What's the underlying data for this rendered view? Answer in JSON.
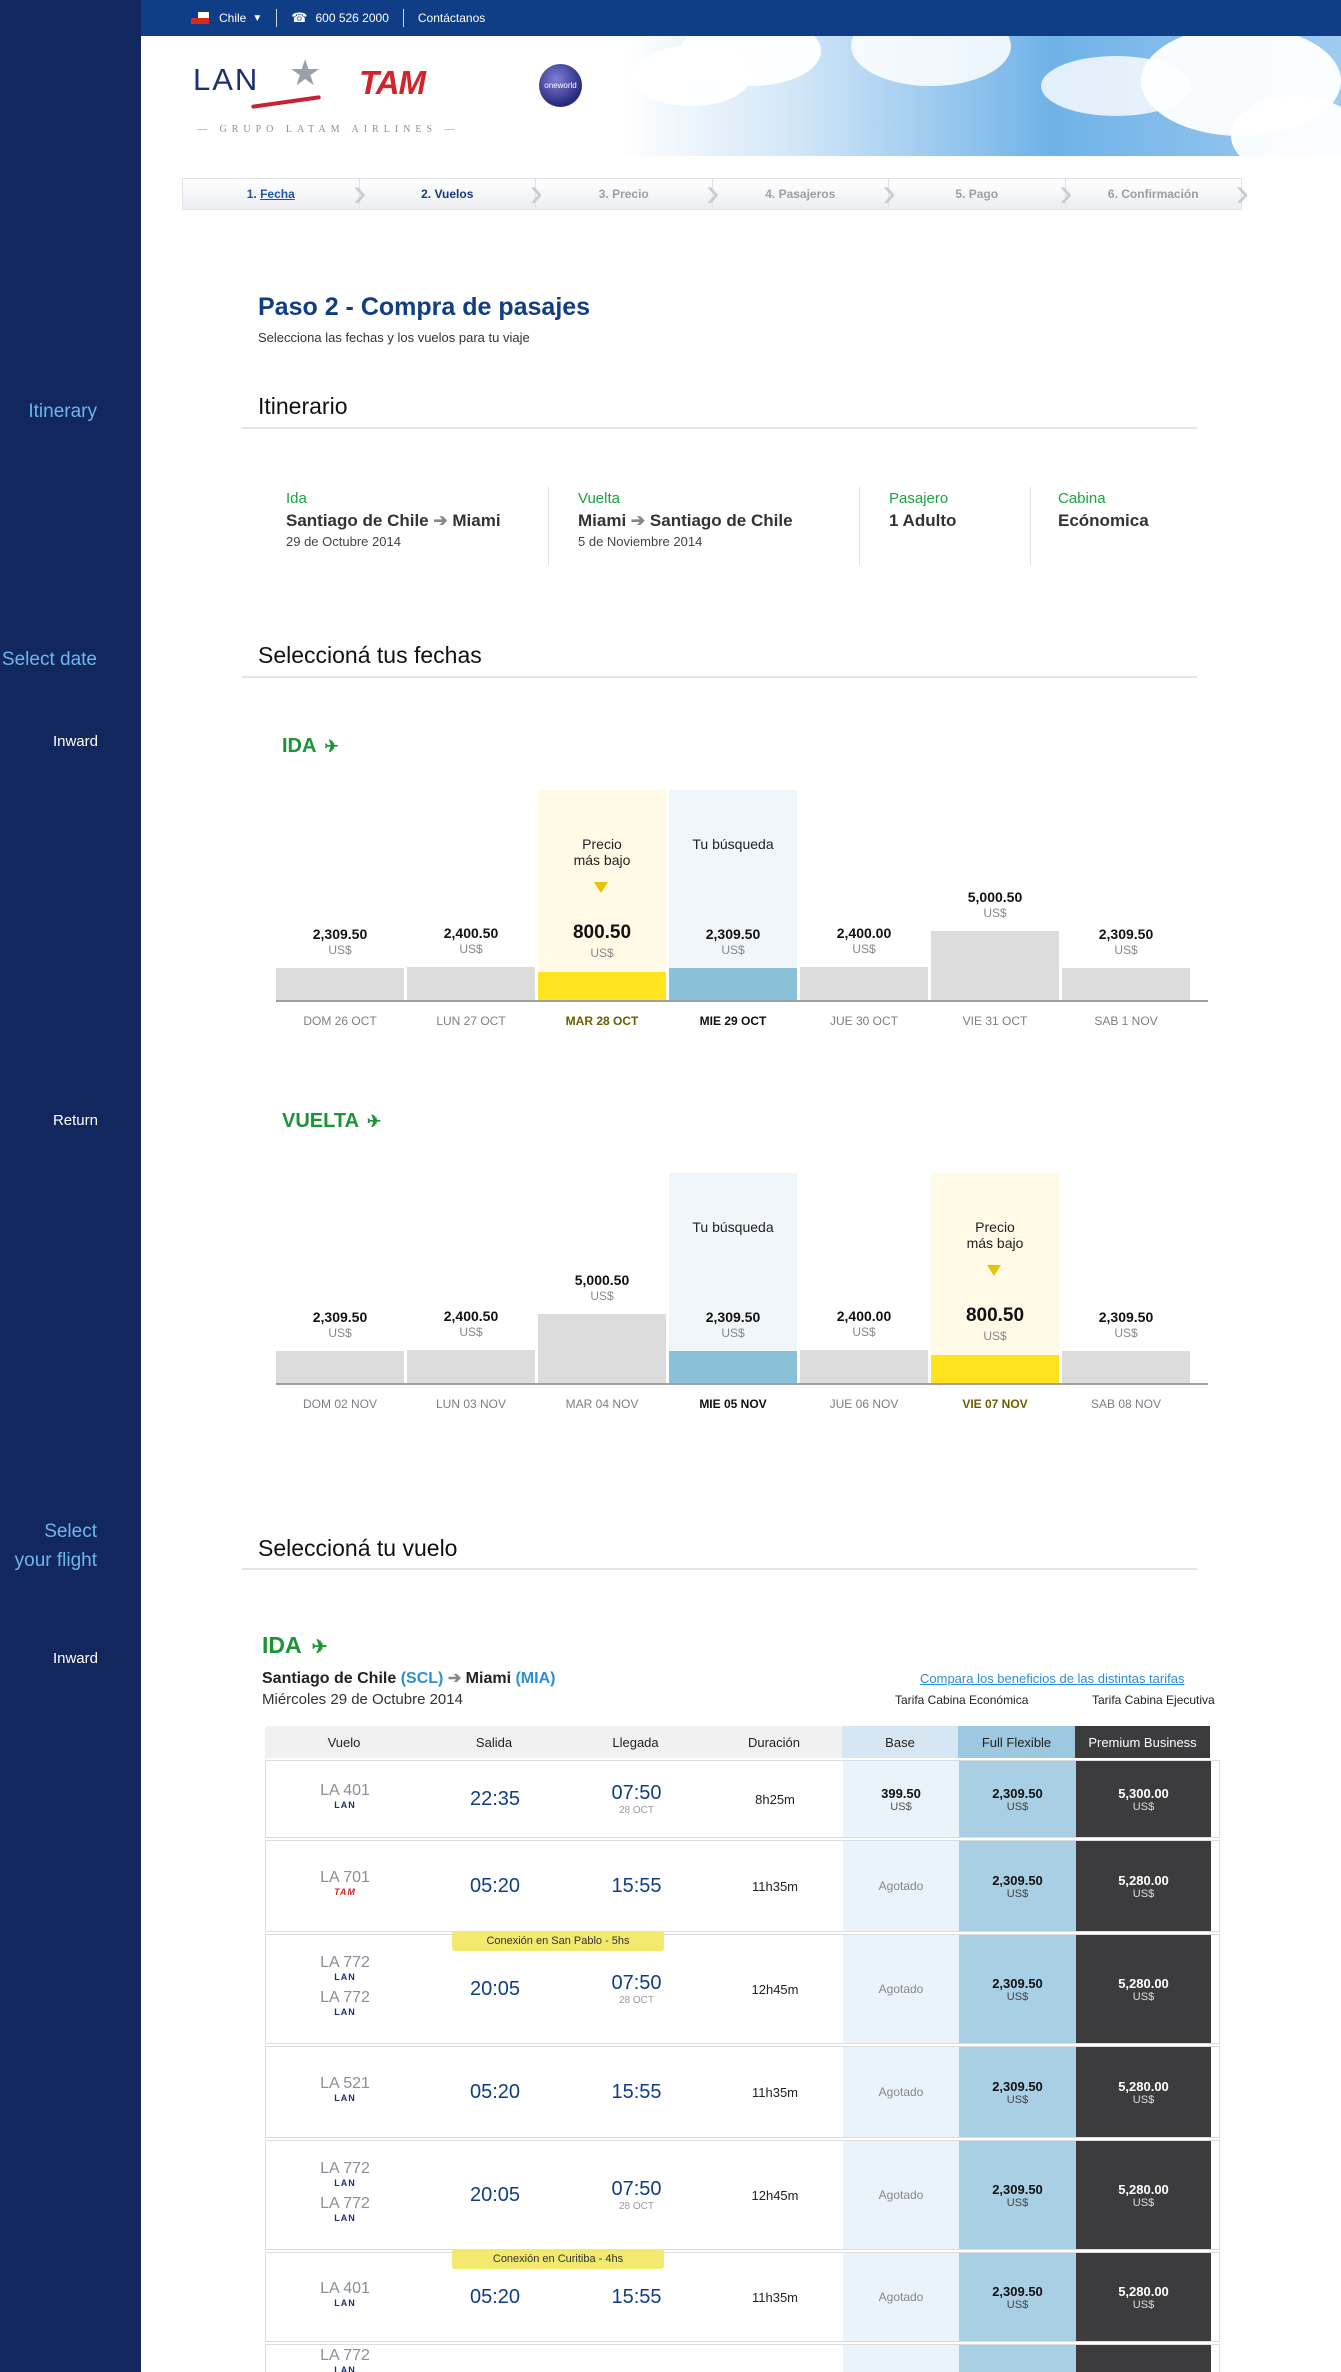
{
  "annotations": {
    "itinerary": "Itinerary",
    "select_date": "Select date",
    "inward_1": "Inward",
    "return": "Return",
    "select_flight_1": "Select",
    "select_flight_2": "your flight",
    "inward_2": "Inward"
  },
  "topbar": {
    "country": "Chile",
    "phone": "600 526 2000",
    "contact": "Contáctanos"
  },
  "brand": {
    "lan": "LAN",
    "tam": "TAM",
    "oneworld": "oneworld",
    "group": "— GRUPO LATAM AIRLINES —"
  },
  "steps": [
    {
      "num": "1.",
      "label": "Fecha"
    },
    {
      "num": "2.",
      "label": "Vuelos"
    },
    {
      "num": "3.",
      "label": "Precio"
    },
    {
      "num": "4.",
      "label": "Pasajeros"
    },
    {
      "num": "5.",
      "label": "Pago"
    },
    {
      "num": "6.",
      "label": "Confirmación"
    }
  ],
  "page": {
    "title": "Paso 2 - Compra de pasajes",
    "subtitle": "Selecciona las fechas y los vuelos para tu viaje"
  },
  "itinerary": {
    "heading": "Itinerario",
    "ida_label": "Ida",
    "ida_from": "Santiago de Chile",
    "ida_to": "Miami",
    "ida_date": "29 de Octubre 2014",
    "vuelta_label": "Vuelta",
    "vuelta_from": "Miami",
    "vuelta_to": "Santiago de Chile",
    "vuelta_date": "5 de Noviembre 2014",
    "pasajero_label": "Pasajero",
    "pasajero_value": "1 Adulto",
    "cabina_label": "Cabina",
    "cabina_value": "Ecónomica"
  },
  "dates": {
    "heading": "Seleccioná tus fechas",
    "currency": "US$",
    "lowest_note_1": "Precio",
    "lowest_note_2": "más bajo",
    "search_note": "Tu búsqueda",
    "ida": {
      "label": "IDA",
      "days": [
        {
          "date": "DOM 26 OCT",
          "price": "2,309.50",
          "value": 2309.5,
          "kind": "normal"
        },
        {
          "date": "LUN 27 OCT",
          "price": "2,400.50",
          "value": 2400.5,
          "kind": "normal"
        },
        {
          "date": "MAR 28 OCT",
          "price": "800.50",
          "value": 800.5,
          "kind": "lowest"
        },
        {
          "date": "MIE 29 OCT",
          "price": "2,309.50",
          "value": 2309.5,
          "kind": "search"
        },
        {
          "date": "JUE 30 OCT",
          "price": "2,400.00",
          "value": 2400.0,
          "kind": "normal"
        },
        {
          "date": "VIE 31 OCT",
          "price": "5,000.50",
          "value": 5000.5,
          "kind": "normal"
        },
        {
          "date": "SAB 1 NOV",
          "price": "2,309.50",
          "value": 2309.5,
          "kind": "normal"
        }
      ]
    },
    "vuelta": {
      "label": "VUELTA",
      "days": [
        {
          "date": "DOM 02 NOV",
          "price": "2,309.50",
          "value": 2309.5,
          "kind": "normal"
        },
        {
          "date": "LUN 03 NOV",
          "price": "2,400.50",
          "value": 2400.5,
          "kind": "normal"
        },
        {
          "date": "MAR 04 NOV",
          "price": "5,000.50",
          "value": 5000.5,
          "kind": "normal"
        },
        {
          "date": "MIE 05 NOV",
          "price": "2,309.50",
          "value": 2309.5,
          "kind": "search"
        },
        {
          "date": "JUE 06 NOV",
          "price": "2,400.00",
          "value": 2400.0,
          "kind": "normal"
        },
        {
          "date": "VIE 07 NOV",
          "price": "800.50",
          "value": 800.5,
          "kind": "lowest"
        },
        {
          "date": "SAB 08 NOV",
          "price": "2,309.50",
          "value": 2309.5,
          "kind": "normal"
        }
      ]
    }
  },
  "flights": {
    "heading": "Seleccioná tu vuelo",
    "dir_label": "IDA",
    "from_city": "Santiago de Chile",
    "from_code": "(SCL)",
    "to_city": "Miami",
    "to_code": "(MIA)",
    "date": "Miércoles 29 de Octubre 2014",
    "compare_link": "Compara los beneficios de las distintas tarifas",
    "cabin_economy": "Tarifa Cabina Económica",
    "cabin_exec": "Tarifa Cabina Ejecutiva",
    "columns": [
      "Vuelo",
      "Salida",
      "Llegada",
      "Duración",
      "Base",
      "Full Flexible",
      "Premium Business"
    ],
    "currency": "US$",
    "sold_out": "Agotado",
    "rows": [
      {
        "flights": [
          {
            "num": "LA 401",
            "carrier": "LAN"
          }
        ],
        "dep": "22:35",
        "arr": "07:50",
        "arr_sub": "28 OCT",
        "dur": "8h25m",
        "base": "399.50",
        "flex": "2,309.50",
        "prem": "5,300.00",
        "conn": ""
      },
      {
        "flights": [
          {
            "num": "LA 701",
            "carrier": "TAM"
          }
        ],
        "dep": "05:20",
        "arr": "15:55",
        "arr_sub": "",
        "dur": "11h35m",
        "base": "",
        "flex": "2,309.50",
        "prem": "5,280.00",
        "conn": ""
      },
      {
        "flights": [
          {
            "num": "LA 772",
            "carrier": "LAN"
          },
          {
            "num": "LA 772",
            "carrier": "LAN"
          }
        ],
        "dep": "20:05",
        "arr": "07:50",
        "arr_sub": "28 OCT",
        "dur": "12h45m",
        "base": "",
        "flex": "2,309.50",
        "prem": "5,280.00",
        "conn": "Conexión en San Pablo - 5hs"
      },
      {
        "flights": [
          {
            "num": "LA 521",
            "carrier": "LAN"
          }
        ],
        "dep": "05:20",
        "arr": "15:55",
        "arr_sub": "",
        "dur": "11h35m",
        "base": "",
        "flex": "2,309.50",
        "prem": "5,280.00",
        "conn": ""
      },
      {
        "flights": [
          {
            "num": "LA 772",
            "carrier": "LAN"
          },
          {
            "num": "LA 772",
            "carrier": "LAN"
          }
        ],
        "dep": "20:05",
        "arr": "07:50",
        "arr_sub": "28 OCT",
        "dur": "12h45m",
        "base": "",
        "flex": "2,309.50",
        "prem": "5,280.00",
        "conn": ""
      },
      {
        "flights": [
          {
            "num": "LA 401",
            "carrier": "LAN"
          }
        ],
        "dep": "05:20",
        "arr": "15:55",
        "arr_sub": "",
        "dur": "11h35m",
        "base": "",
        "flex": "2,309.50",
        "prem": "5,280.00",
        "conn": "Conexión en Curitiba - 4hs"
      },
      {
        "flights": [
          {
            "num": "LA 772",
            "carrier": "LAN"
          }
        ],
        "dep": "",
        "arr": "",
        "arr_sub": "",
        "dur": "",
        "base": "",
        "flex": "",
        "prem": "",
        "conn": ""
      }
    ]
  },
  "colors": {
    "brand_blue": "#0f3d86",
    "green": "#1b9436",
    "lowest_yellow": "#ffe31f",
    "search_blue": "#8bc1d8",
    "sidebar": "#12275e"
  }
}
